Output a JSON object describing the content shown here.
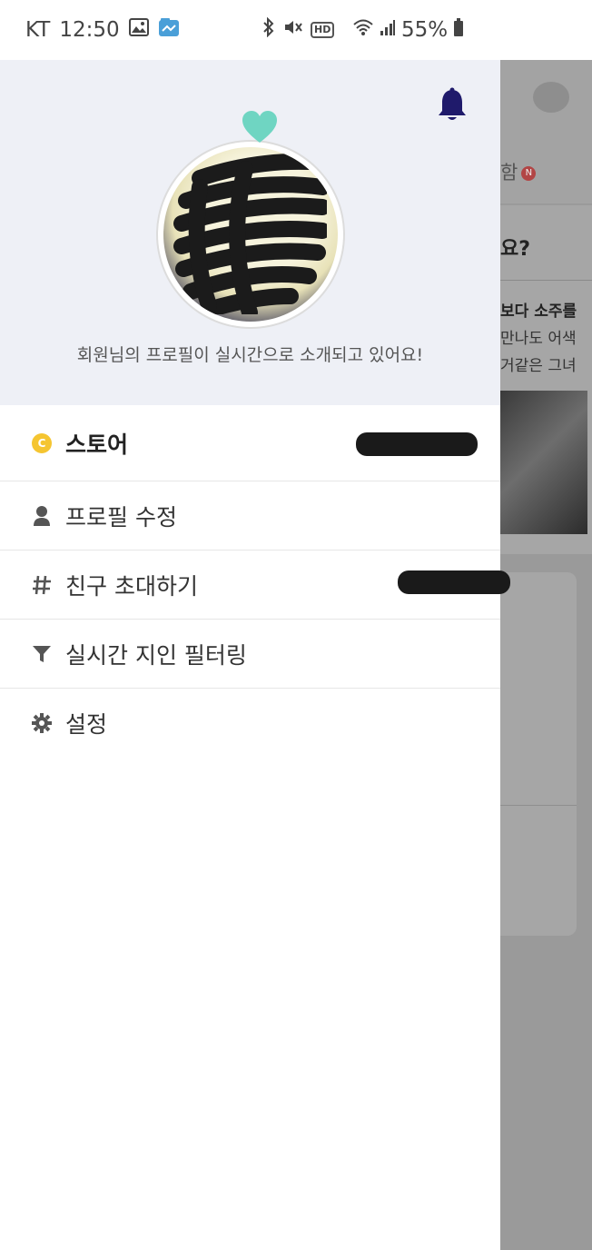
{
  "status_bar": {
    "carrier": "KT",
    "time": "12:50",
    "hd": "HD",
    "battery": "55%"
  },
  "drawer": {
    "header": {
      "profile_caption": "회원님의 프로필이 실시간으로 소개되고 있어요!"
    },
    "menu": [
      {
        "label": "스토어",
        "icon": "coin-icon",
        "coin_letter": "C"
      },
      {
        "label": "프로필 수정",
        "icon": "person-icon"
      },
      {
        "label": "친구 초대하기",
        "icon": "hash-icon"
      },
      {
        "label": "실시간 지인 필터링",
        "icon": "filter-icon"
      },
      {
        "label": "설정",
        "icon": "gear-icon"
      }
    ]
  },
  "background_app": {
    "tab_label": "함",
    "tab_badge": "N",
    "question_fragment": "요?",
    "line1": "보다 소주를",
    "line2": "만나도 어색",
    "line3": "거같은 그녀"
  },
  "colors": {
    "header_bg": "#eef0f6",
    "bell": "#1f1a6b",
    "heart": "#6fd5c2",
    "coin": "#f5c531",
    "dim_overlay": "#9a9a9a"
  }
}
